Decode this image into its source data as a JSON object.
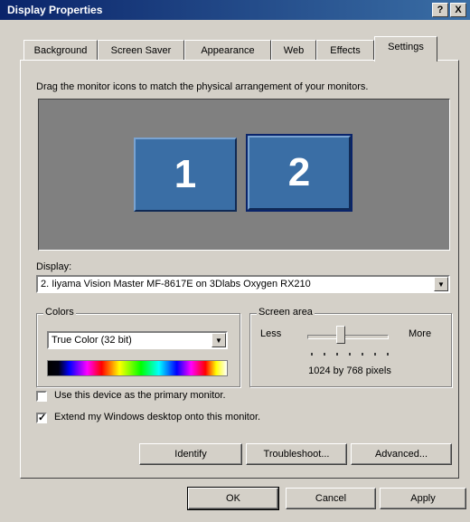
{
  "window": {
    "title": "Display Properties",
    "help_btn": "?",
    "close_btn": "X"
  },
  "tabs": [
    {
      "label": "Background",
      "active": false
    },
    {
      "label": "Screen Saver",
      "active": false
    },
    {
      "label": "Appearance",
      "active": false
    },
    {
      "label": "Web",
      "active": false
    },
    {
      "label": "Effects",
      "active": false
    },
    {
      "label": "Settings",
      "active": true
    }
  ],
  "settings": {
    "instruction": "Drag the monitor icons to match the physical arrangement of your monitors.",
    "monitors": [
      "1",
      "2"
    ],
    "display_label": "Display:",
    "display_value": "2. Iiyama Vision Master MF-8617E on 3Dlabs Oxygen RX210",
    "colors": {
      "group_label": "Colors",
      "value": "True Color (32 bit)"
    },
    "screen_area": {
      "group_label": "Screen area",
      "less": "Less",
      "more": "More",
      "resolution": "1024 by 768 pixels"
    },
    "checkbox_primary": {
      "label": "Use this device as the primary monitor.",
      "checked": false
    },
    "checkbox_extend": {
      "label": "Extend my Windows desktop onto this monitor.",
      "checked": true,
      "mark": "✓"
    },
    "buttons": {
      "identify": "Identify",
      "troubleshoot": "Troubleshoot...",
      "advanced": "Advanced..."
    }
  },
  "footer": {
    "ok": "OK",
    "cancel": "Cancel",
    "apply": "Apply"
  },
  "colors": {
    "titlebar_start": "#0a246a",
    "titlebar_end": "#3a6ea5",
    "monitor_fill": "#3a6ea5",
    "face": "#d4d0c8"
  }
}
